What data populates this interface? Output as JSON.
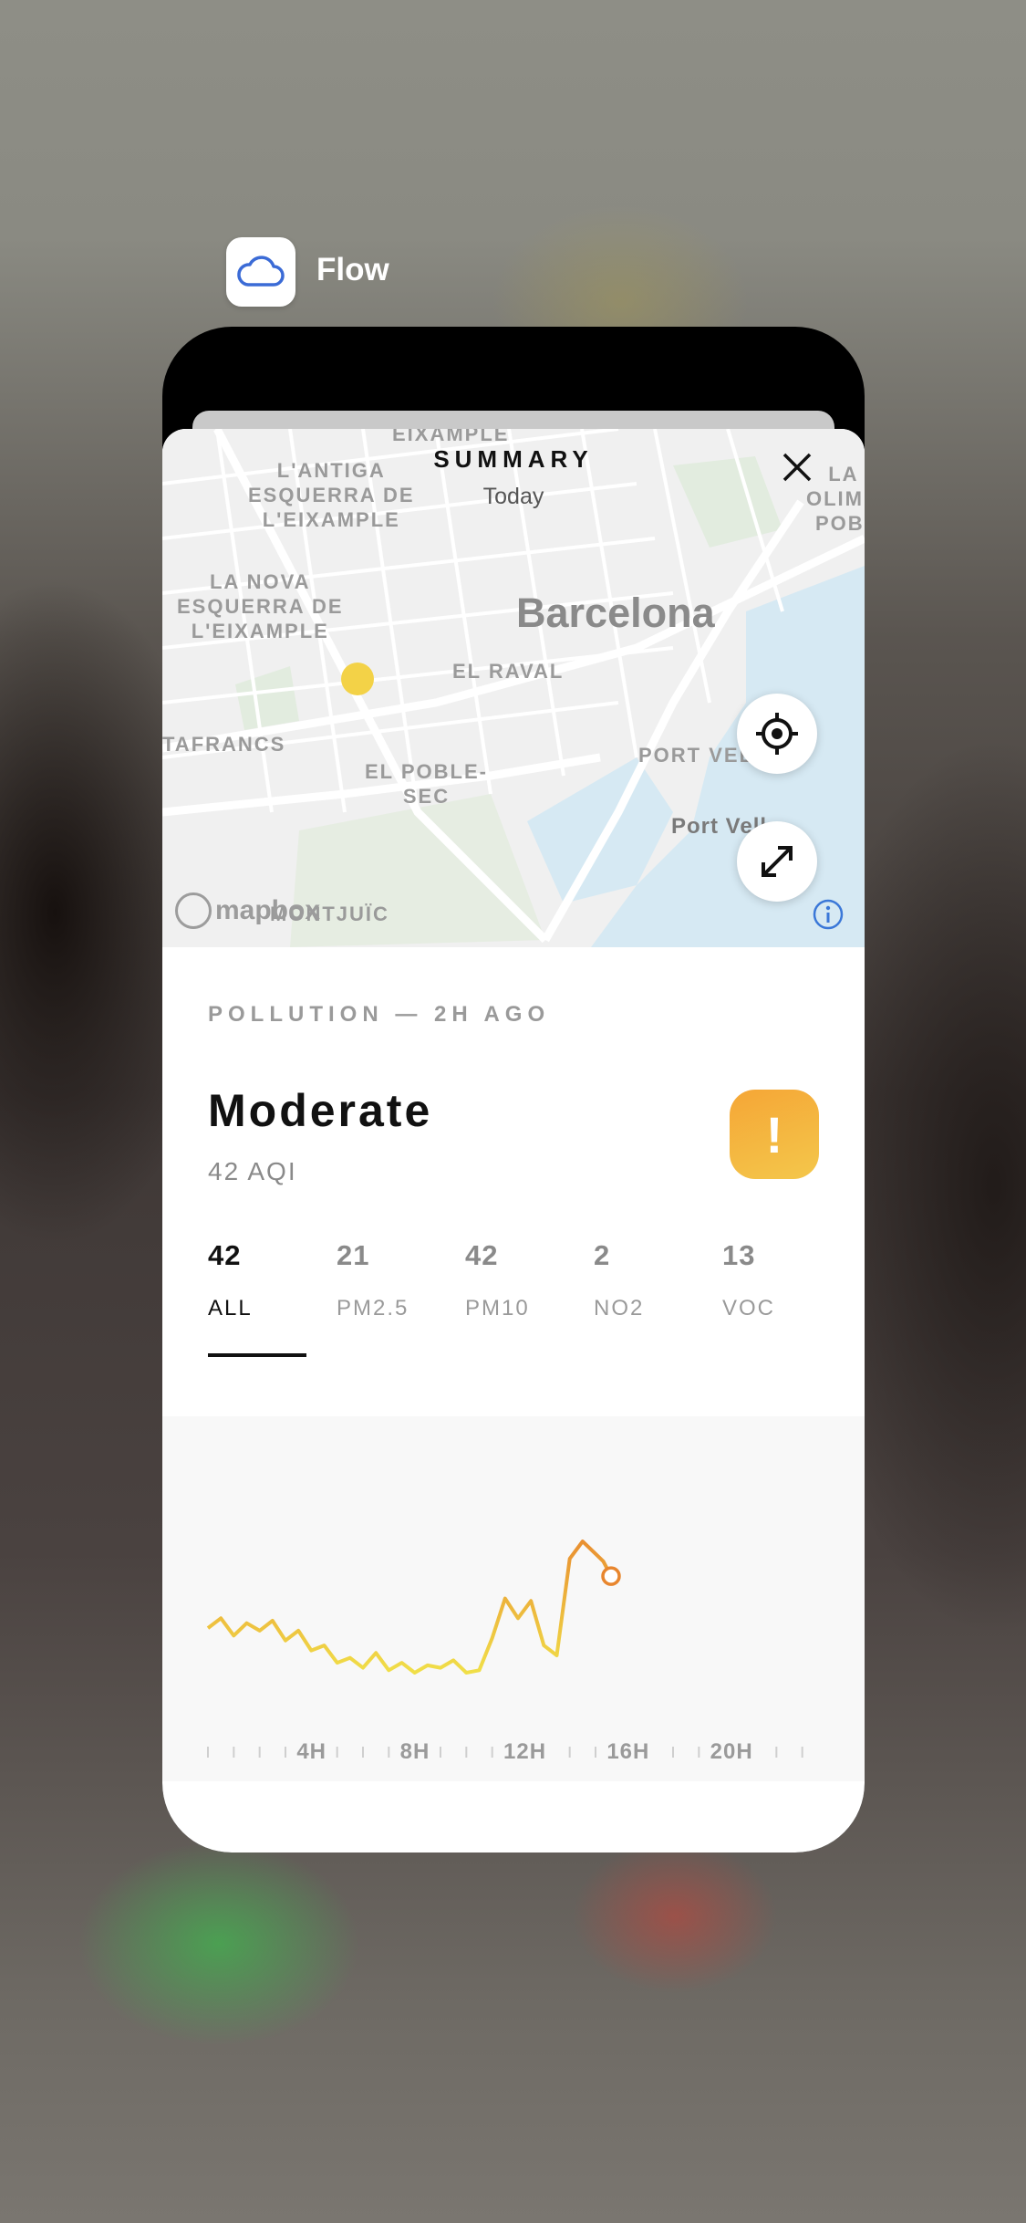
{
  "app": {
    "name": "Flow",
    "icon": "cloud-icon"
  },
  "header": {
    "title": "SUMMARY",
    "subtitle": "Today"
  },
  "map": {
    "city": "Barcelona",
    "labels": {
      "eixample": "EIXAMPLE",
      "antiga": "L'ANTIGA\nESQUERRA DE\nL'EIXAMPLE",
      "nova": "LA NOVA\nESQUERRA DE\nL'EIXAMPLE",
      "raval": "EL RAVAL",
      "sants": "TAFRANCS",
      "poble_sec": "EL POBLE-\nSEC",
      "port_vell": "PORT VEL",
      "port_vell_water": "Port Vell",
      "vila_olimpica": "LA V\nOLIMPIC\nPOBLE",
      "montjuic": "MONTJUÏC"
    },
    "attribution": "mapbox",
    "locate_icon": "crosshair-icon",
    "expand_icon": "expand-arrows-icon",
    "info_icon": "info-icon"
  },
  "pollution": {
    "label": "POLLUTION — 2H AGO",
    "level": "Moderate",
    "aqi_text": "42 AQI",
    "badge": "!",
    "badge_colors": [
      "#f5a636",
      "#f4c74b"
    ]
  },
  "tabs": [
    {
      "value": "42",
      "label": "ALL",
      "active": true
    },
    {
      "value": "21",
      "label": "PM2.5",
      "active": false
    },
    {
      "value": "42",
      "label": "PM10",
      "active": false
    },
    {
      "value": "2",
      "label": "NO2",
      "active": false
    },
    {
      "value": "13",
      "label": "VOC",
      "active": false
    }
  ],
  "chart_data": {
    "type": "line",
    "x_tick_labels": [
      "4H",
      "8H",
      "12H",
      "16H",
      "20H"
    ],
    "x": [
      0,
      0.5,
      1,
      1.5,
      2,
      2.5,
      3,
      3.5,
      4,
      4.5,
      5,
      5.5,
      6,
      6.5,
      7,
      7.5,
      8,
      8.5,
      9,
      9.5,
      10,
      10.5,
      11,
      11.5,
      12,
      12.5,
      13,
      13.5,
      14,
      14.5,
      15,
      15.3,
      15.6
    ],
    "values": [
      45,
      49,
      42,
      47,
      44,
      48,
      40,
      44,
      36,
      38,
      31,
      33,
      29,
      35,
      28,
      31,
      27,
      30,
      29,
      32,
      27,
      28,
      41,
      57,
      49,
      56,
      38,
      34,
      73,
      80,
      75,
      72,
      66
    ],
    "current_marker_x": 15.6,
    "colors": {
      "high": "#e8862e",
      "low": "#f1e44a"
    }
  }
}
